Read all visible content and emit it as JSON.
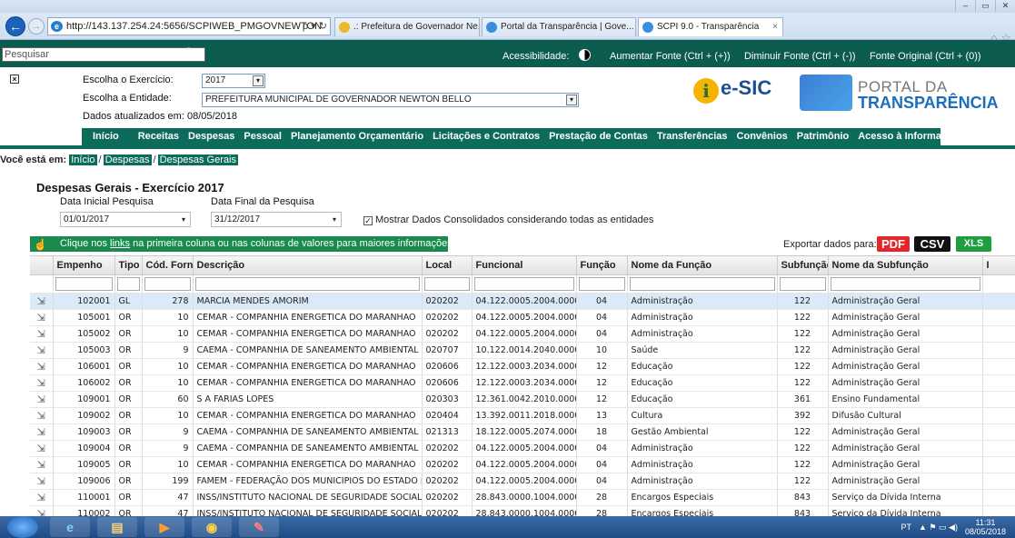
{
  "browser": {
    "address": "http://143.137.254.24:5656/SCPIWEB_PMGOVNEWTON",
    "address_tools": "ρ ▾ ↻",
    "tabs": [
      {
        "label": ".: Prefeitura de Governador Ne...",
        "active": false
      },
      {
        "label": "Portal da Transparência | Gove...",
        "active": false
      },
      {
        "label": "SCPI 9.0 - Transparência",
        "active": true
      }
    ],
    "tab_close": "×",
    "back": "←",
    "forward": "→",
    "win_controls": [
      "–",
      "▭",
      "✕"
    ],
    "tool_icons": "⌂ ☆"
  },
  "sitebar": {
    "search_placeholder": "Pesquisar",
    "search_icon": "⚲",
    "accessibility_label": "Acessibilidade:",
    "font_increase": "Aumentar Fonte (Ctrl + (+))",
    "font_decrease": "Diminuir Fonte (Ctrl + (-))",
    "font_original": "Fonte Original (Ctrl + (0))"
  },
  "header": {
    "close_box": "×",
    "exercise_label": "Escolha o Exercício:",
    "exercise_value": "2017",
    "entity_label": "Escolha a Entidade:",
    "entity_value": "PREFEITURA MUNICIPAL DE GOVERNADOR NEWTON BELLO",
    "updated": "Dados atualizados em: 08/05/2018",
    "select_arrow": "▾",
    "esic_mark": "i",
    "esic_text": "e-SIC",
    "portal_line1": "PORTAL DA",
    "portal_line2": "TRANSPARÊNCIA"
  },
  "nav": [
    "Início",
    "Receitas",
    "Despesas",
    "Pessoal",
    "Planejamento Orçamentário",
    "Licitações e Contratos",
    "Prestação de Contas",
    "Transferências",
    "Convênios",
    "Patrimônio",
    "Acesso à Informação"
  ],
  "breadcrumb": {
    "label": "Você está em:",
    "items": [
      "Início",
      "Despesas",
      "Despesas Gerais"
    ],
    "sep": "/"
  },
  "filters": {
    "title": "Despesas Gerais - Exercício 2017",
    "start_label": "Data Inicial Pesquisa",
    "start_value": "01/01/2017",
    "end_label": "Data Final da Pesquisa",
    "end_value": "31/12/2017",
    "dropdown_arrow": "▾",
    "consolidated_check": "✓",
    "consolidated_label": "Mostrar Dados Consolidados considerando todas as entidades"
  },
  "infobar": {
    "pre": "Clique nos ",
    "link": "links",
    "post": " na primeira coluna ou nas colunas de valores para maiores informações.",
    "hand_icon": "☝"
  },
  "export": {
    "label": "Exportar dados para:",
    "pdf": "PDF",
    "csv": "CSV",
    "xls": "XLS",
    "colors": {
      "pdf": "#e3262b",
      "csv": "#111111",
      "xls": "#1e9e3e"
    }
  },
  "table": {
    "columns": [
      "",
      "Empenho",
      "Tipo",
      "Cód. Forn.",
      "Descrição",
      "Local",
      "Funcional",
      "Função",
      "Nome da Função",
      "Subfunção",
      "Nome da Subfunção",
      "I"
    ],
    "row_icon": "⇲",
    "rows": [
      [
        "102001",
        "GL",
        "278",
        "MARCIA MENDES AMORIM",
        "020202",
        "04.122.0005.2004.0000",
        "04",
        "Administração",
        "122",
        "Administração Geral"
      ],
      [
        "105001",
        "OR",
        "10",
        "CEMAR - COMPANHIA ENERGETICA DO MARANHAO",
        "020202",
        "04.122.0005.2004.0000",
        "04",
        "Administração",
        "122",
        "Administração Geral"
      ],
      [
        "105002",
        "OR",
        "10",
        "CEMAR - COMPANHIA ENERGETICA DO MARANHAO",
        "020202",
        "04.122.0005.2004.0000",
        "04",
        "Administração",
        "122",
        "Administração Geral"
      ],
      [
        "105003",
        "OR",
        "9",
        "CAEMA - COMPANHIA DE SANEAMENTO AMBIENTAL D",
        "020707",
        "10.122.0014.2040.0000",
        "10",
        "Saúde",
        "122",
        "Administração Geral"
      ],
      [
        "106001",
        "OR",
        "10",
        "CEMAR - COMPANHIA ENERGETICA DO MARANHAO",
        "020606",
        "12.122.0003.2034.0000",
        "12",
        "Educação",
        "122",
        "Administração Geral"
      ],
      [
        "106002",
        "OR",
        "10",
        "CEMAR - COMPANHIA ENERGETICA DO MARANHAO",
        "020606",
        "12.122.0003.2034.0000",
        "12",
        "Educação",
        "122",
        "Administração Geral"
      ],
      [
        "109001",
        "OR",
        "60",
        "S A FARIAS LOPES",
        "020303",
        "12.361.0042.2010.0000",
        "12",
        "Educação",
        "361",
        "Ensino Fundamental"
      ],
      [
        "109002",
        "OR",
        "10",
        "CEMAR - COMPANHIA ENERGETICA DO MARANHAO",
        "020404",
        "13.392.0011.2018.0000",
        "13",
        "Cultura",
        "392",
        "Difusão Cultural"
      ],
      [
        "109003",
        "OR",
        "9",
        "CAEMA - COMPANHIA DE SANEAMENTO AMBIENTAL D",
        "021313",
        "18.122.0005.2074.0000",
        "18",
        "Gestão Ambiental",
        "122",
        "Administração Geral"
      ],
      [
        "109004",
        "OR",
        "9",
        "CAEMA - COMPANHIA DE SANEAMENTO AMBIENTAL D",
        "020202",
        "04.122.0005.2004.0000",
        "04",
        "Administração",
        "122",
        "Administração Geral"
      ],
      [
        "109005",
        "OR",
        "10",
        "CEMAR - COMPANHIA ENERGETICA DO MARANHAO",
        "020202",
        "04.122.0005.2004.0000",
        "04",
        "Administração",
        "122",
        "Administração Geral"
      ],
      [
        "109006",
        "OR",
        "199",
        "FAMEM - FEDERAÇÃO DOS MUNICIPIOS DO ESTADO D",
        "020202",
        "04.122.0005.2004.0000",
        "04",
        "Administração",
        "122",
        "Administração Geral"
      ],
      [
        "110001",
        "OR",
        "47",
        "INSS/INSTITUTO NACIONAL DE SEGURIDADE SOCIAL",
        "020202",
        "28.843.0000.1004.0000",
        "28",
        "Encargos Especiais",
        "843",
        "Serviço da Dívida Interna"
      ],
      [
        "110002",
        "OR",
        "47",
        "INSS/INSTITUTO NACIONAL DE SEGURIDADE SOCIAL",
        "020202",
        "28.843.0000.1004.0000",
        "28",
        "Encargos Especiais",
        "843",
        "Serviço da Dívida Interna"
      ]
    ]
  },
  "taskbar": {
    "apps": [
      "e",
      "▤",
      "▶",
      "◉",
      "✎"
    ],
    "lang": "PT",
    "tray_icons": "▲ ⚑ ▭ ◀)",
    "time": "11:31",
    "date": "08/05/2018"
  }
}
